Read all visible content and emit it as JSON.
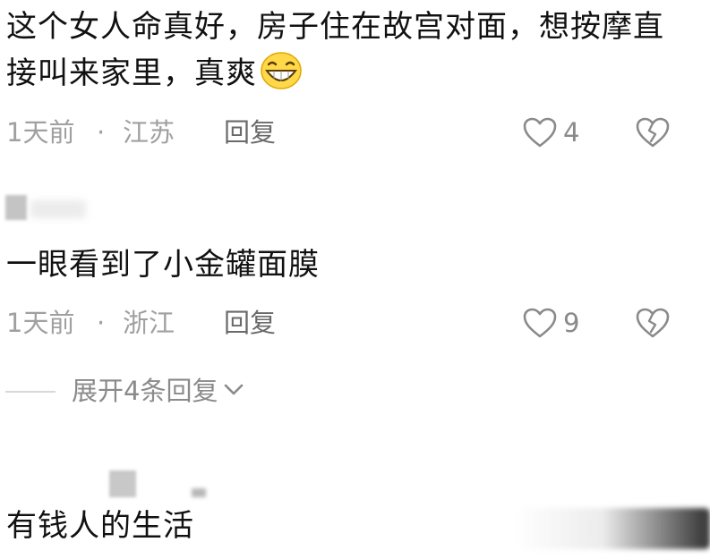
{
  "comments": [
    {
      "text": "这个女人命真好，房子住在故宫对面，想按摩直接叫来家里，真爽",
      "emoji": "grinning-face-emoji",
      "time": "1天前",
      "separator": "·",
      "location": "江苏",
      "reply_label": "回复",
      "likes": "4"
    },
    {
      "text": "一眼看到了小金罐面膜",
      "time": "1天前",
      "separator": "·",
      "location": "浙江",
      "reply_label": "回复",
      "likes": "9",
      "expand_label": "展开4条回复"
    },
    {
      "text": "有钱人的生活"
    }
  ],
  "icons": {
    "like": "heart-outline-icon",
    "dislike": "broken-heart-icon",
    "expand": "chevron-down-icon"
  },
  "colors": {
    "text": "#111111",
    "meta": "#a0a0a0",
    "icon": "#8a8a8a"
  }
}
